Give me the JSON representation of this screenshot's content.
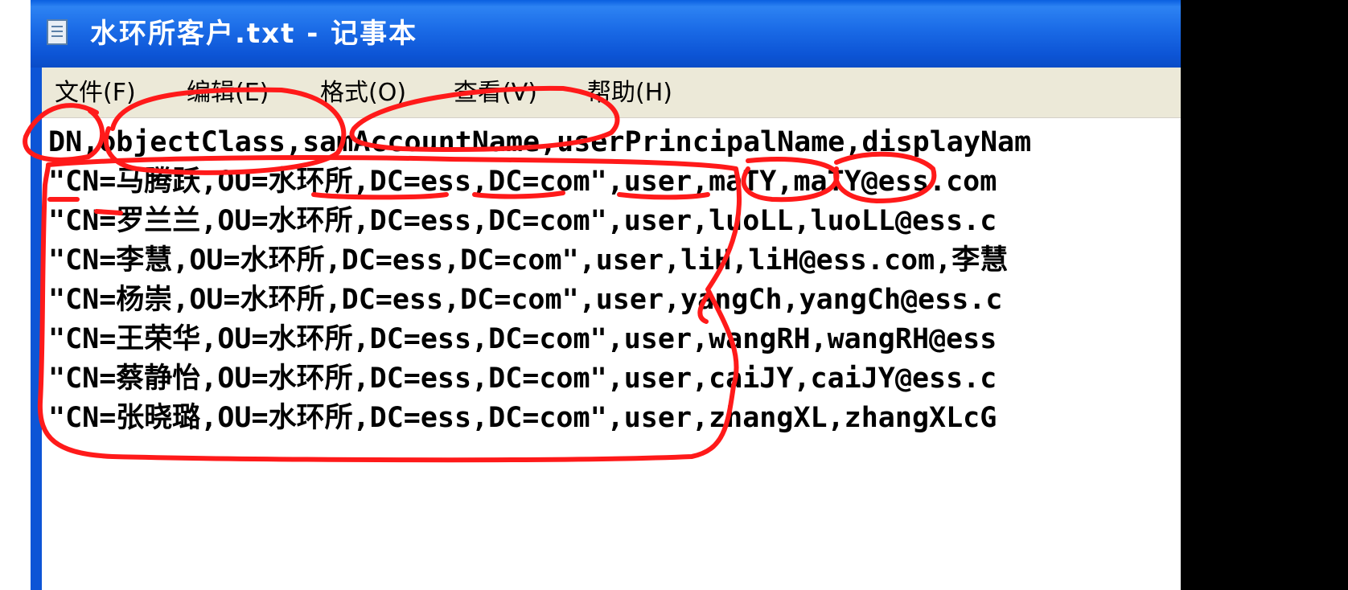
{
  "window": {
    "title": "水环所客户.txt - 记事本"
  },
  "menu": {
    "items": [
      "文件(F)",
      "编辑(E)",
      "格式(O)",
      "查看(V)",
      "帮助(H)"
    ]
  },
  "editor": {
    "lines": [
      "DN,objectClass,samAccountName,userPrincipalName,displayNam",
      "\"CN=马腾跃,OU=水环所,DC=ess,DC=com\",user,maTY,maTY@ess.com",
      "\"CN=罗兰兰,OU=水环所,DC=ess,DC=com\",user,luoLL,luoLL@ess.c",
      "\"CN=李慧,OU=水环所,DC=ess,DC=com\",user,liH,liH@ess.com,李慧",
      "\"CN=杨崇,OU=水环所,DC=ess,DC=com\",user,yangCh,yangCh@ess.c",
      "\"CN=王荣华,OU=水环所,DC=ess,DC=com\",user,wangRH,wangRH@ess",
      "\"CN=蔡静怡,OU=水环所,DC=ess,DC=com\",user,caiJY,caiJY@ess.c",
      "\"CN=张晓璐,OU=水环所,DC=ess,DC=com\",user,zhangXL,zhangXLcG"
    ]
  },
  "colors": {
    "titlebar": "#0d55d6",
    "menubar": "#ece9d8",
    "annotation": "#ff0000"
  },
  "icons": {
    "title": "notepad-icon"
  }
}
